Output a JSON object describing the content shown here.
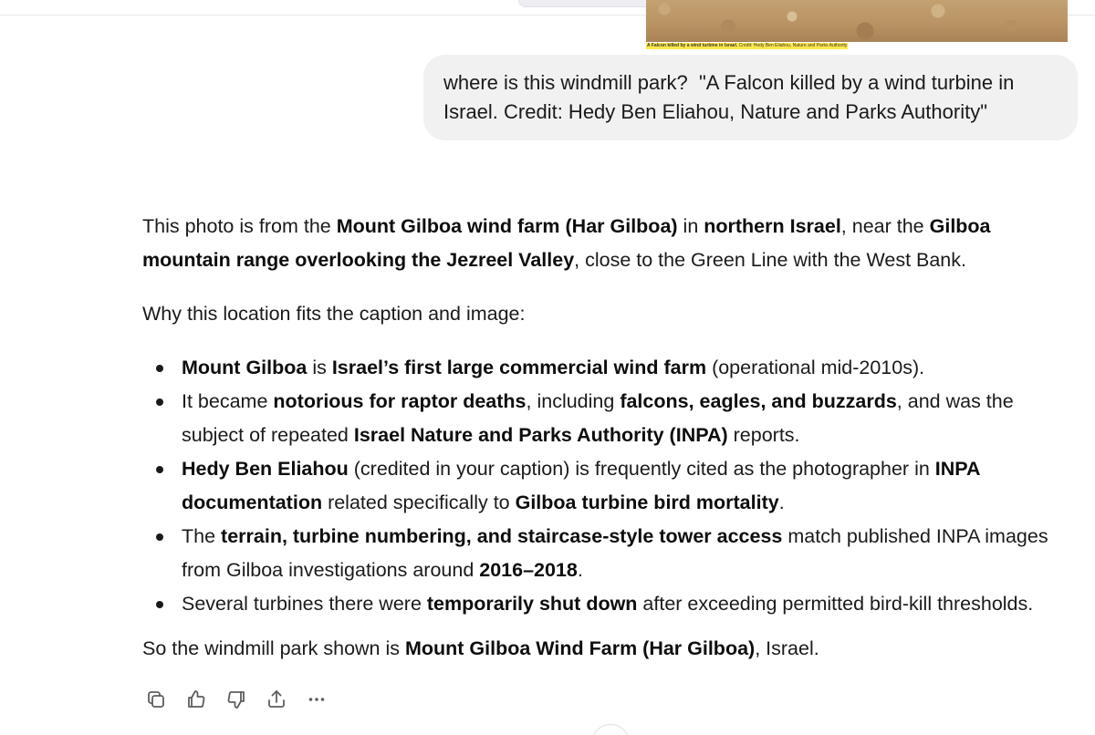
{
  "attachment": {
    "caption_bold": "A Falcon killed by a wind turbine in Israel.",
    "caption_rest": "Credit: Hedy Ben Eliahou, Nature and Parks Authority"
  },
  "user_message": {
    "text": "where is this windmill park?  \"A Falcon killed by a wind turbine in Israel. Credit: Hedy Ben Eliahou, Nature and Parks Authority\""
  },
  "assistant_message": {
    "intro": {
      "t1": "This photo is from the ",
      "b1": "Mount Gilboa wind farm (Har Gilboa)",
      "t2": " in ",
      "b2": "northern Israel",
      "t3": ", near the ",
      "b3": "Gilboa mountain range overlooking the Jezreel Valley",
      "t4": ", close to the Green Line with the West Bank."
    },
    "why": "Why this location fits the caption and image:",
    "bullets": [
      {
        "b1": "Mount Gilboa",
        "t1": " is ",
        "b2": "Israel’s first large commercial wind farm",
        "t2": " (operational mid-2010s)."
      },
      {
        "t1": "It became ",
        "b1": "notorious for raptor deaths",
        "t2": ", including ",
        "b2": "falcons, eagles, and buzzards",
        "t3": ", and was the subject of repeated ",
        "b3": "Israel Nature and Parks Authority (INPA)",
        "t4": " reports."
      },
      {
        "b1": "Hedy Ben Eliahou",
        "t1": " (credited in your caption) is frequently cited as the photographer in ",
        "b2": "INPA documentation",
        "t2": " related specifically to ",
        "b3": "Gilboa turbine bird mortality",
        "t3": "."
      },
      {
        "t1": "The ",
        "b1": "terrain, turbine numbering, and staircase-style tower access",
        "t2": " match published INPA images from Gilboa investigations around ",
        "b2": "2016–2018",
        "t3": "."
      },
      {
        "t1": "Several turbines there were ",
        "b1": "temporarily shut down",
        "t2": " after exceeding permitted bird-kill thresholds."
      }
    ],
    "final": {
      "t1": "So the windmill park shown is ",
      "b1": "Mount Gilboa Wind Farm (Har Gilboa)",
      "t2": ", Israel."
    }
  },
  "actions": {
    "icons": [
      "copy-icon",
      "thumbs-up-icon",
      "thumbs-down-icon",
      "share-icon",
      "more-icon"
    ]
  },
  "colors": {
    "user_bubble": "#f1f1f1",
    "text": "#1a1a1a",
    "caption_highlight": "#ffe94a"
  }
}
